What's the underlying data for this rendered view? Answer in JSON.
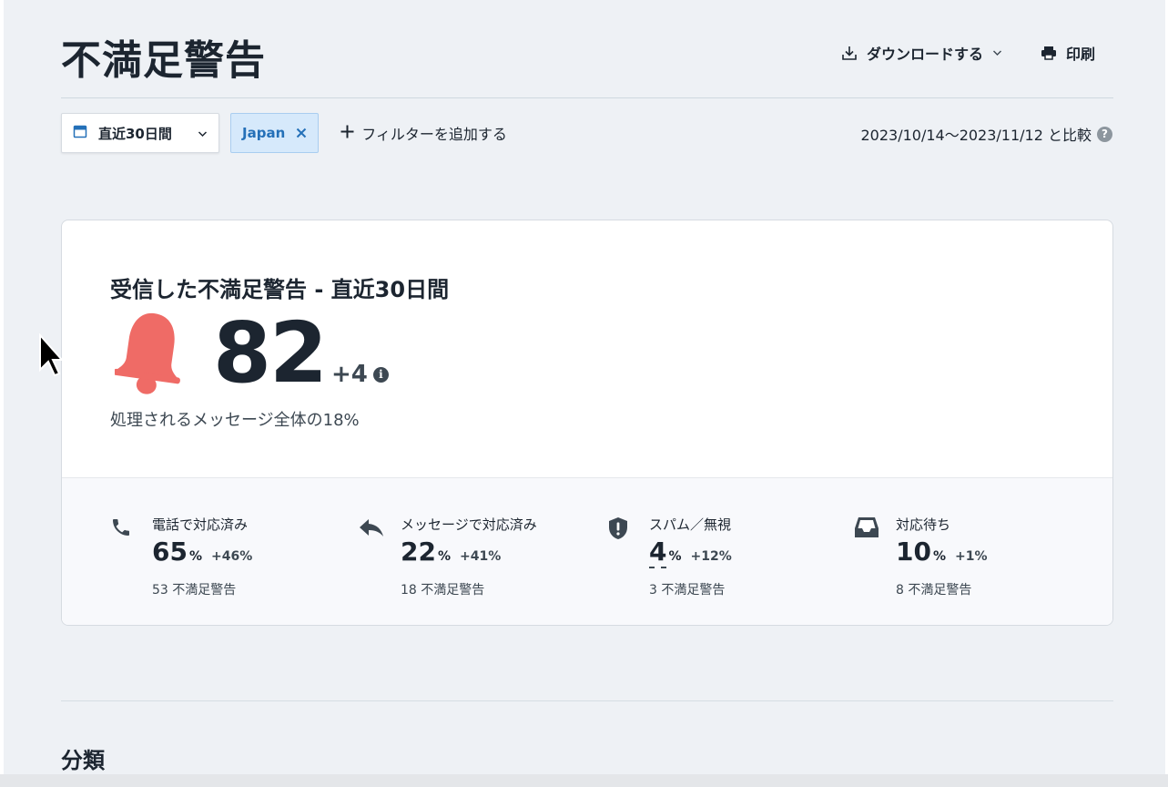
{
  "page": {
    "title": "不満足警告"
  },
  "header": {
    "download_label": "ダウンロードする",
    "print_label": "印刷"
  },
  "filters": {
    "date_range": "直近30日間",
    "chip_label": "Japan",
    "add_filter_label": "フィルターを追加する",
    "compare_text": "2023/10/14〜2023/11/12 と比較"
  },
  "summary": {
    "title": "受信した不満足警告 - 直近30日間",
    "count": "82",
    "delta": "+4",
    "share_text": "処理されるメッセージ全体の18%",
    "bell_color": "#ef6b66"
  },
  "metrics": [
    {
      "icon": "phone-icon",
      "label": "電話で対応済み",
      "percent": "65",
      "unit": "%",
      "change": "+46%",
      "count": "53 不満足警告"
    },
    {
      "icon": "reply-icon",
      "label": "メッセージで対応済み",
      "percent": "22",
      "unit": "%",
      "change": "+41%",
      "count": "18 不満足警告"
    },
    {
      "icon": "shield-alert-icon",
      "label": "スパム／無視",
      "percent": "4",
      "unit": "%",
      "change": "+12%",
      "count": "3 不満足警告"
    },
    {
      "icon": "inbox-icon",
      "label": "対応待ち",
      "percent": "10",
      "unit": "%",
      "change": "+1%",
      "count": "8 不満足警告"
    }
  ],
  "section": {
    "title": "分類"
  }
}
